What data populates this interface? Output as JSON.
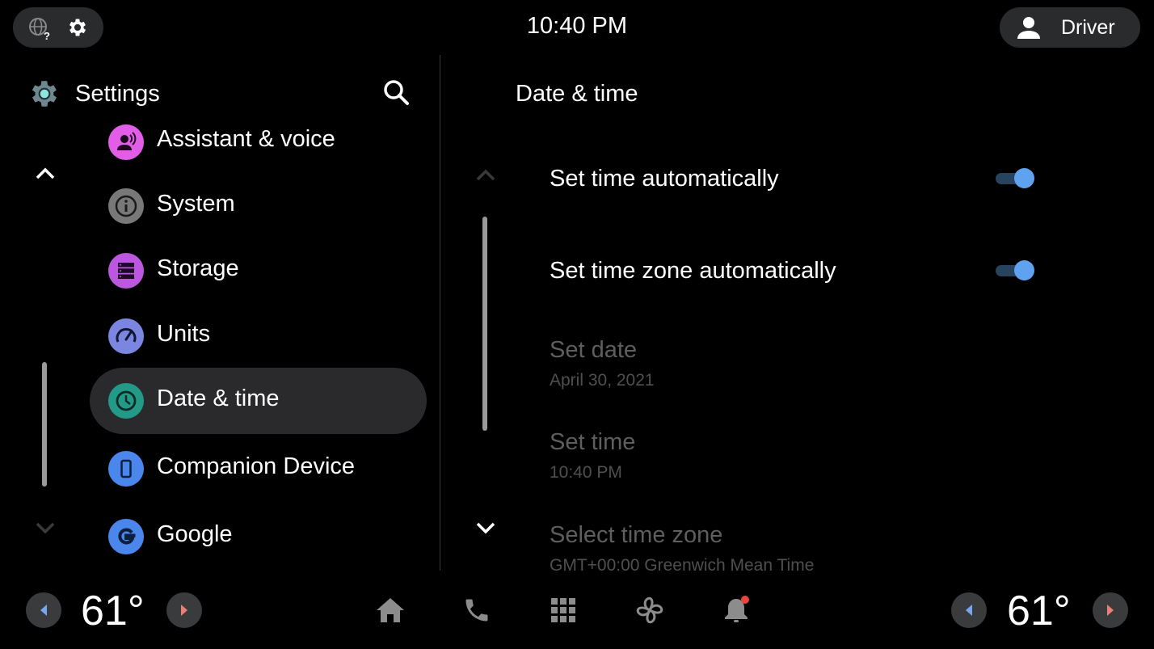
{
  "status_bar": {
    "time": "10:40 PM",
    "user_label": "Driver",
    "left_icons": [
      "language-unknown-icon",
      "settings-gear-icon"
    ]
  },
  "left_panel": {
    "title": "Settings",
    "search_icon": "search-icon",
    "items": [
      {
        "label": "Assistant & voice",
        "icon": "assistant-voice-icon",
        "color": "#e35ee8",
        "selected": false
      },
      {
        "label": "System",
        "icon": "info-icon",
        "color": "#787878",
        "selected": false
      },
      {
        "label": "Storage",
        "icon": "storage-icon",
        "color": "#bc57e0",
        "selected": false
      },
      {
        "label": "Units",
        "icon": "speedometer-icon",
        "color": "#7a86e0",
        "selected": false
      },
      {
        "label": "Date & time",
        "icon": "clock-icon",
        "color": "#229a87",
        "selected": true
      },
      {
        "label": "Companion Device",
        "icon": "phone-device-icon",
        "color": "#4a86ec",
        "selected": false
      },
      {
        "label": "Google",
        "icon": "google-icon",
        "color": "#4a86ec",
        "selected": false
      }
    ]
  },
  "right_panel": {
    "title": "Date & time",
    "rows": [
      {
        "title": "Set time automatically",
        "toggle": true,
        "enabled": true
      },
      {
        "title": "Set time zone automatically",
        "toggle": true,
        "enabled": true
      },
      {
        "title": "Set date",
        "subtitle": "April 30, 2021",
        "enabled": false
      },
      {
        "title": "Set time",
        "subtitle": "10:40 PM",
        "enabled": false
      },
      {
        "title": "Select time zone",
        "subtitle": "GMT+00:00 Greenwich Mean Time",
        "enabled": false
      }
    ]
  },
  "bottom_bar": {
    "left_temp": "61°",
    "right_temp": "61°",
    "dock": [
      "home-icon",
      "phone-icon",
      "app-grid-icon",
      "fan-icon",
      "notification-bell-icon"
    ],
    "notification_dot_color": "#e8453c",
    "temp_down_color": "#7aa6f0",
    "temp_up_color": "#e88078"
  }
}
